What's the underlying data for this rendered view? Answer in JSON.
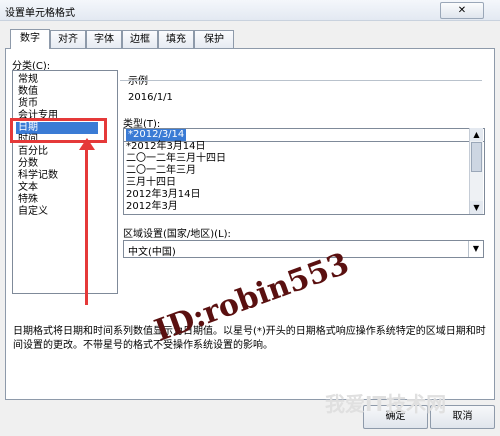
{
  "window": {
    "title": "设置单元格格式",
    "close_label": "✕"
  },
  "tabs": [
    {
      "label": "数字",
      "active": true
    },
    {
      "label": "对齐"
    },
    {
      "label": "字体"
    },
    {
      "label": "边框"
    },
    {
      "label": "填充"
    },
    {
      "label": "保护"
    }
  ],
  "category": {
    "label": "分类(C):",
    "items": [
      "常规",
      "数值",
      "货币",
      "会计专用",
      "日期",
      "时间",
      "百分比",
      "分数",
      "科学记数",
      "文本",
      "特殊",
      "自定义"
    ],
    "selected": "日期"
  },
  "sample": {
    "label": "示例",
    "value": "2016/1/1"
  },
  "type": {
    "label": "类型(T):",
    "input_value": "",
    "items": [
      "*2012/3/14",
      "*2012年3月14日",
      "二〇一二年三月十四日",
      "二〇一二年三月",
      "三月十四日",
      "2012年3月14日",
      "2012年3月"
    ],
    "selected": "*2012/3/14"
  },
  "locale": {
    "label": "区域设置(国家/地区)(L):",
    "value": "中文(中国)"
  },
  "description": "日期格式将日期和时间系列数值显示为日期值。以星号(*)开头的日期格式响应操作系统特定的区域日期和时间设置的更改。不带星号的格式不受操作系统设置的影响。",
  "buttons": {
    "ok": "确定",
    "cancel": "取消"
  },
  "watermark": {
    "id_text": "ID:robin553",
    "site_text": "我爱IT技术网"
  },
  "colors": {
    "highlight": "#3a7bd5",
    "annotation_red": "#e53939"
  },
  "icons": {
    "close": "close-icon",
    "dropdown": "chevron-down-icon",
    "scroll_up": "scroll-up-icon",
    "scroll_down": "scroll-down-icon"
  }
}
